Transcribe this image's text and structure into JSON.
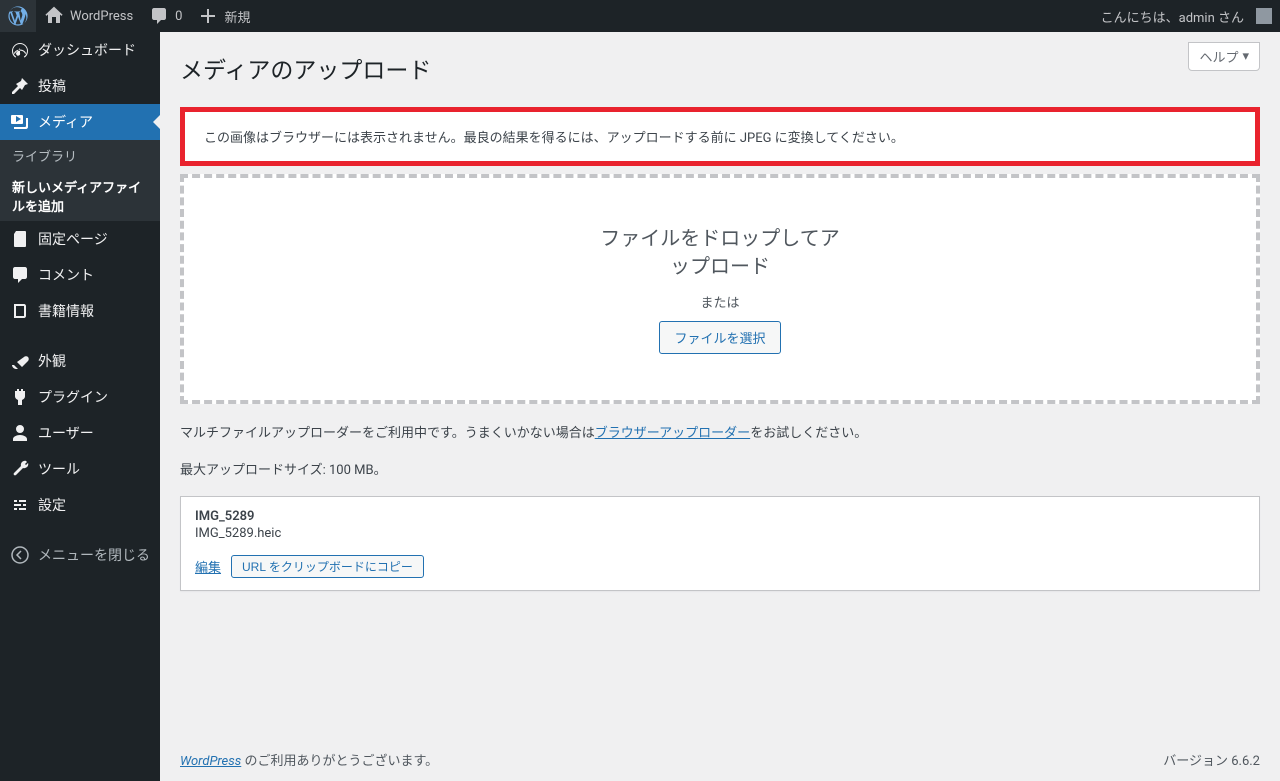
{
  "adminbar": {
    "site": "WordPress",
    "comments": "0",
    "new": "新規",
    "greeting": "こんにちは、admin さん"
  },
  "sidebar": {
    "dashboard": "ダッシュボード",
    "posts": "投稿",
    "media": "メディア",
    "media_sub": {
      "library": "ライブラリ",
      "add_new": "新しいメディアファイルを追加"
    },
    "pages": "固定ページ",
    "comments": "コメント",
    "books": "書籍情報",
    "appearance": "外観",
    "plugins": "プラグイン",
    "users": "ユーザー",
    "tools": "ツール",
    "settings": "設定",
    "collapse": "メニューを閉じる"
  },
  "page": {
    "help": "ヘルプ",
    "title": "メディアのアップロード",
    "notice": "この画像はブラウザーには表示されません。最良の結果を得るには、アップロードする前に JPEG に変換してください。",
    "drop_title": "ファイルをドロップしてアップロード",
    "or": "または",
    "select_btn": "ファイルを選択",
    "uploader_help_pre": "マルチファイルアップローダーをご利用中です。うまくいかない場合は",
    "uploader_help_link": "ブラウザーアップローダー",
    "uploader_help_post": "をお試しください。",
    "max_size": "最大アップロードサイズ: 100 MB。",
    "media_item": {
      "title": "IMG_5289",
      "filename": "IMG_5289.heic",
      "edit": "編集",
      "copy_url": "URL をクリップボードにコピー"
    }
  },
  "footer": {
    "wp_link": "WordPress",
    "thanks": " のご利用ありがとうございます。",
    "version": "バージョン 6.6.2"
  }
}
